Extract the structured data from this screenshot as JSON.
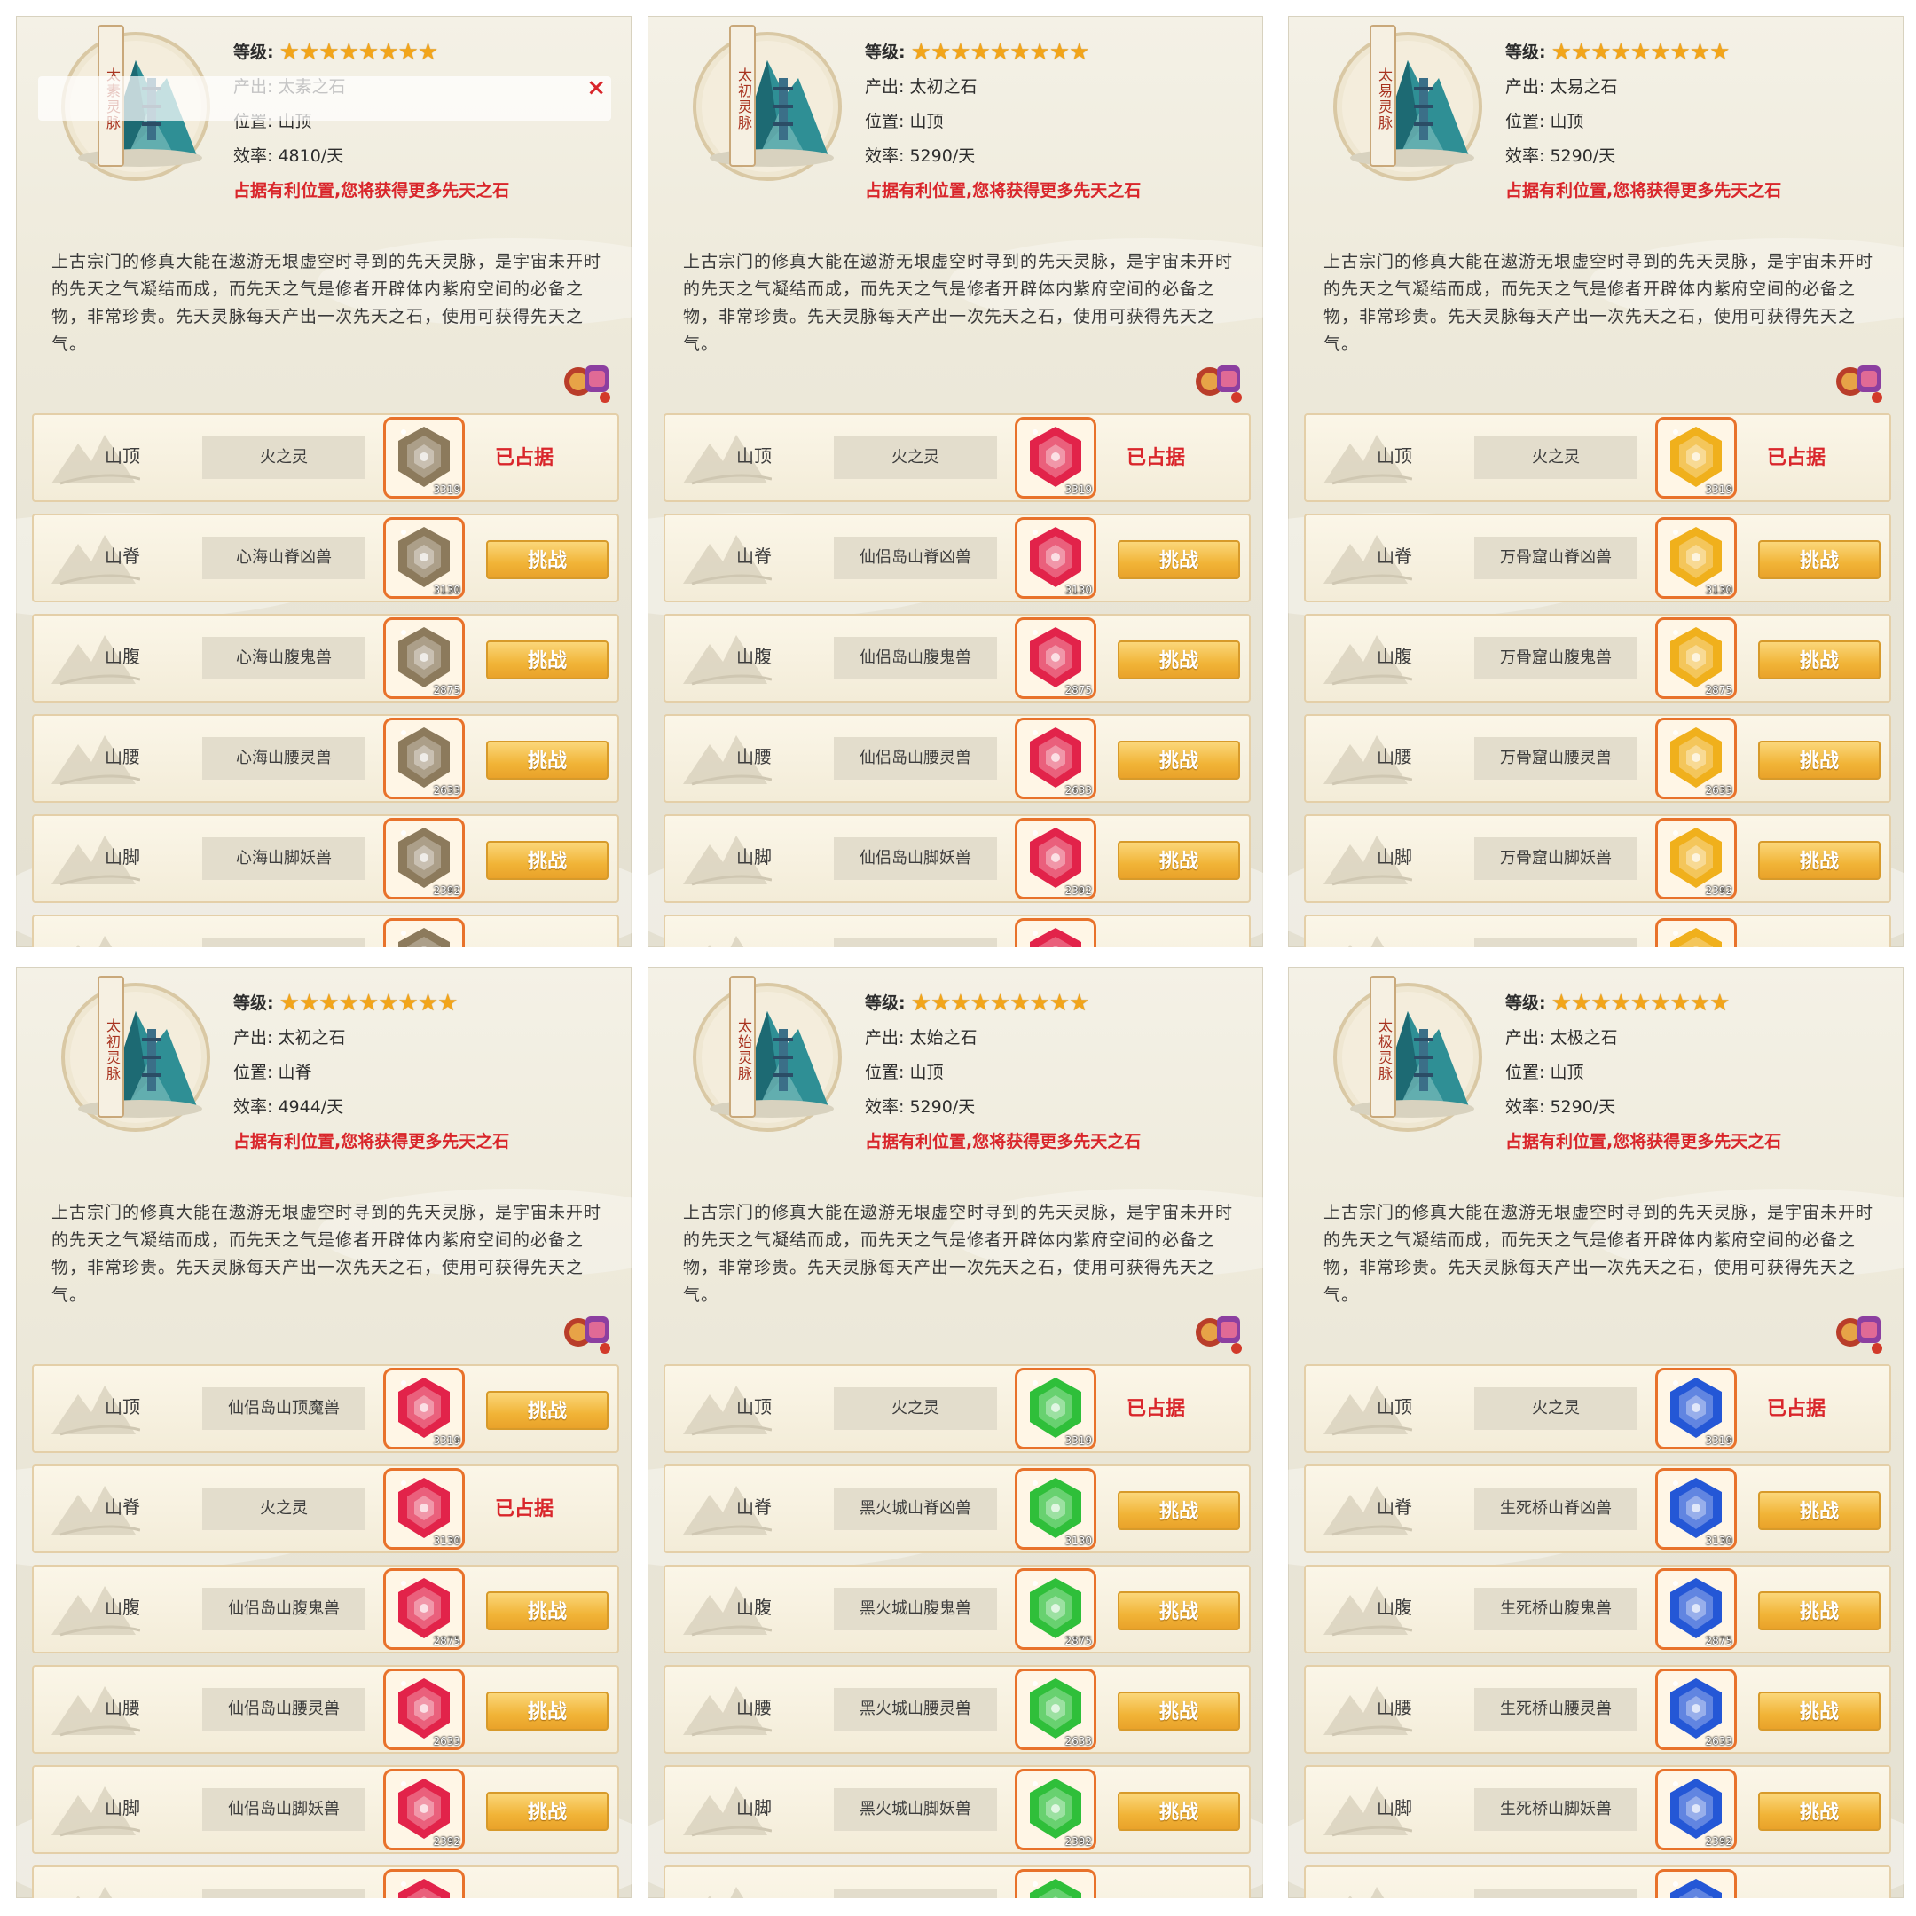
{
  "colors": {
    "warn": "#d9262b",
    "star": "#f2a51a",
    "button": "#f1b437",
    "gem_border": "#e8722b"
  },
  "panels": [
    {
      "tag": "太素灵脉",
      "level_label": "等级:",
      "stars": "★★★★★★★★",
      "output": "产出: 太素之石",
      "position": "位置: 山顶",
      "efficiency": "效率: 4810/天",
      "warning": "占据有利位置,您将获得更多先天之石",
      "description": "上古宗门的修真大能在遨游无垠虚空时寻到的先天灵脉，是宇宙未开时的先天之气凝结而成，而先天之气是修者开辟体内紫府空间的必备之物，非常珍贵。先天灵脉每天产出一次先天之石，使用可获得先天之气。",
      "gem_color": "#8c7a5c",
      "has_popup": true,
      "popup_close": "×",
      "rows": [
        {
          "loc": "山顶",
          "name": "火之灵",
          "gem": "3319",
          "status": "已占据",
          "button": ""
        },
        {
          "loc": "山脊",
          "name": "心海山脊凶兽",
          "gem": "3130",
          "status": "",
          "button": "挑战"
        },
        {
          "loc": "山腹",
          "name": "心海山腹鬼兽",
          "gem": "2875",
          "status": "",
          "button": "挑战"
        },
        {
          "loc": "山腰",
          "name": "心海山腰灵兽",
          "gem": "2633",
          "status": "",
          "button": "挑战"
        },
        {
          "loc": "山脚",
          "name": "心海山脚妖兽",
          "gem": "2392",
          "status": "",
          "button": "挑战"
        },
        {
          "loc": "",
          "name": "",
          "gem": "",
          "status": "",
          "button": ""
        }
      ]
    },
    {
      "tag": "太初灵脉",
      "level_label": "等级:",
      "stars": "★★★★★★★★★",
      "output": "产出: 太初之石",
      "position": "位置: 山顶",
      "efficiency": "效率: 5290/天",
      "warning": "占据有利位置,您将获得更多先天之石",
      "description": "上古宗门的修真大能在遨游无垠虚空时寻到的先天灵脉，是宇宙未开时的先天之气凝结而成，而先天之气是修者开辟体内紫府空间的必备之物，非常珍贵。先天灵脉每天产出一次先天之石，使用可获得先天之气。",
      "gem_color": "#e2234a",
      "has_popup": false,
      "popup_close": "",
      "rows": [
        {
          "loc": "山顶",
          "name": "火之灵",
          "gem": "3319",
          "status": "已占据",
          "button": ""
        },
        {
          "loc": "山脊",
          "name": "仙侣岛山脊凶兽",
          "gem": "3130",
          "status": "",
          "button": "挑战"
        },
        {
          "loc": "山腹",
          "name": "仙侣岛山腹鬼兽",
          "gem": "2875",
          "status": "",
          "button": "挑战"
        },
        {
          "loc": "山腰",
          "name": "仙侣岛山腰灵兽",
          "gem": "2633",
          "status": "",
          "button": "挑战"
        },
        {
          "loc": "山脚",
          "name": "仙侣岛山脚妖兽",
          "gem": "2392",
          "status": "",
          "button": "挑战"
        },
        {
          "loc": "",
          "name": "",
          "gem": "",
          "status": "",
          "button": ""
        }
      ]
    },
    {
      "tag": "太易灵脉",
      "level_label": "等级:",
      "stars": "★★★★★★★★★",
      "output": "产出: 太易之石",
      "position": "位置: 山顶",
      "efficiency": "效率: 5290/天",
      "warning": "占据有利位置,您将获得更多先天之石",
      "description": "上古宗门的修真大能在遨游无垠虚空时寻到的先天灵脉，是宇宙未开时的先天之气凝结而成，而先天之气是修者开辟体内紫府空间的必备之物，非常珍贵。先天灵脉每天产出一次先天之石，使用可获得先天之气。",
      "gem_color": "#f0b01c",
      "has_popup": false,
      "popup_close": "",
      "rows": [
        {
          "loc": "山顶",
          "name": "火之灵",
          "gem": "3319",
          "status": "已占据",
          "button": ""
        },
        {
          "loc": "山脊",
          "name": "万骨窟山脊凶兽",
          "gem": "3130",
          "status": "",
          "button": "挑战"
        },
        {
          "loc": "山腹",
          "name": "万骨窟山腹鬼兽",
          "gem": "2875",
          "status": "",
          "button": "挑战"
        },
        {
          "loc": "山腰",
          "name": "万骨窟山腰灵兽",
          "gem": "2633",
          "status": "",
          "button": "挑战"
        },
        {
          "loc": "山脚",
          "name": "万骨窟山脚妖兽",
          "gem": "2392",
          "status": "",
          "button": "挑战"
        },
        {
          "loc": "",
          "name": "",
          "gem": "",
          "status": "",
          "button": ""
        }
      ]
    },
    {
      "tag": "太初灵脉",
      "level_label": "等级:",
      "stars": "★★★★★★★★★",
      "output": "产出: 太初之石",
      "position": "位置: 山脊",
      "efficiency": "效率: 4944/天",
      "warning": "占据有利位置,您将获得更多先天之石",
      "description": "上古宗门的修真大能在遨游无垠虚空时寻到的先天灵脉，是宇宙未开时的先天之气凝结而成，而先天之气是修者开辟体内紫府空间的必备之物，非常珍贵。先天灵脉每天产出一次先天之石，使用可获得先天之气。",
      "gem_color": "#e2234a",
      "has_popup": false,
      "popup_close": "",
      "rows": [
        {
          "loc": "山顶",
          "name": "仙侣岛山顶魔兽",
          "gem": "3319",
          "status": "",
          "button": "挑战"
        },
        {
          "loc": "山脊",
          "name": "火之灵",
          "gem": "3130",
          "status": "已占据",
          "button": ""
        },
        {
          "loc": "山腹",
          "name": "仙侣岛山腹鬼兽",
          "gem": "2875",
          "status": "",
          "button": "挑战"
        },
        {
          "loc": "山腰",
          "name": "仙侣岛山腰灵兽",
          "gem": "2633",
          "status": "",
          "button": "挑战"
        },
        {
          "loc": "山脚",
          "name": "仙侣岛山脚妖兽",
          "gem": "2392",
          "status": "",
          "button": "挑战"
        },
        {
          "loc": "",
          "name": "",
          "gem": "",
          "status": "",
          "button": ""
        }
      ]
    },
    {
      "tag": "太始灵脉",
      "level_label": "等级:",
      "stars": "★★★★★★★★★",
      "output": "产出: 太始之石",
      "position": "位置: 山顶",
      "efficiency": "效率: 5290/天",
      "warning": "占据有利位置,您将获得更多先天之石",
      "description": "上古宗门的修真大能在遨游无垠虚空时寻到的先天灵脉，是宇宙未开时的先天之气凝结而成，而先天之气是修者开辟体内紫府空间的必备之物，非常珍贵。先天灵脉每天产出一次先天之石，使用可获得先天之气。",
      "gem_color": "#2fbf3a",
      "has_popup": false,
      "popup_close": "",
      "rows": [
        {
          "loc": "山顶",
          "name": "火之灵",
          "gem": "3319",
          "status": "已占据",
          "button": ""
        },
        {
          "loc": "山脊",
          "name": "黑火城山脊凶兽",
          "gem": "3130",
          "status": "",
          "button": "挑战"
        },
        {
          "loc": "山腹",
          "name": "黑火城山腹鬼兽",
          "gem": "2875",
          "status": "",
          "button": "挑战"
        },
        {
          "loc": "山腰",
          "name": "黑火城山腰灵兽",
          "gem": "2633",
          "status": "",
          "button": "挑战"
        },
        {
          "loc": "山脚",
          "name": "黑火城山脚妖兽",
          "gem": "2392",
          "status": "",
          "button": "挑战"
        },
        {
          "loc": "",
          "name": "",
          "gem": "",
          "status": "",
          "button": ""
        }
      ]
    },
    {
      "tag": "太极灵脉",
      "level_label": "等级:",
      "stars": "★★★★★★★★★",
      "output": "产出: 太极之石",
      "position": "位置: 山顶",
      "efficiency": "效率: 5290/天",
      "warning": "占据有利位置,您将获得更多先天之石",
      "description": "上古宗门的修真大能在遨游无垠虚空时寻到的先天灵脉，是宇宙未开时的先天之气凝结而成，而先天之气是修者开辟体内紫府空间的必备之物，非常珍贵。先天灵脉每天产出一次先天之石，使用可获得先天之气。",
      "gem_color": "#2457d6",
      "has_popup": false,
      "popup_close": "",
      "rows": [
        {
          "loc": "山顶",
          "name": "火之灵",
          "gem": "3319",
          "status": "已占据",
          "button": ""
        },
        {
          "loc": "山脊",
          "name": "生死桥山脊凶兽",
          "gem": "3130",
          "status": "",
          "button": "挑战"
        },
        {
          "loc": "山腹",
          "name": "生死桥山腹鬼兽",
          "gem": "2875",
          "status": "",
          "button": "挑战"
        },
        {
          "loc": "山腰",
          "name": "生死桥山腰灵兽",
          "gem": "2633",
          "status": "",
          "button": "挑战"
        },
        {
          "loc": "山脚",
          "name": "生死桥山脚妖兽",
          "gem": "2392",
          "status": "",
          "button": "挑战"
        },
        {
          "loc": "",
          "name": "",
          "gem": "",
          "status": "",
          "button": ""
        }
      ]
    }
  ]
}
